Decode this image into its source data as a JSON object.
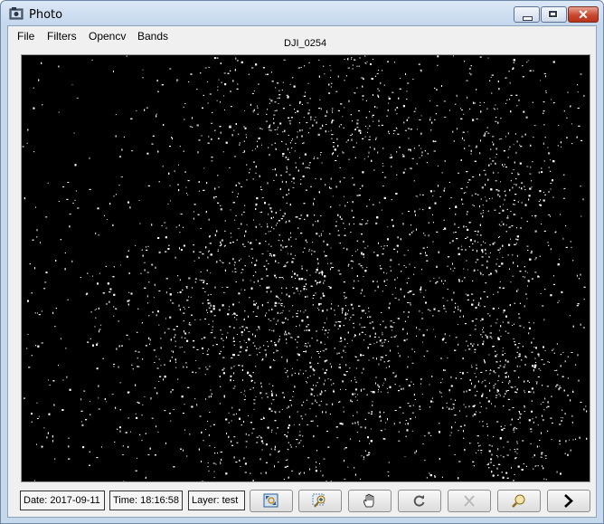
{
  "window": {
    "title": "Photo",
    "controls": {
      "minimize": "minimize",
      "maximize": "maximize",
      "close": "✕"
    }
  },
  "menu": {
    "items": [
      {
        "label": "File"
      },
      {
        "label": "Filters"
      },
      {
        "label": "Opencv"
      },
      {
        "label": "Bands"
      }
    ]
  },
  "photo": {
    "name": "DJI_0254",
    "content": "black background with scattered white edge-detection speckles"
  },
  "status": {
    "date": "Date: 2017-09-11",
    "time": "Time: 18:16:58",
    "layer": "Layer: test"
  },
  "toolbar": {
    "buttons": [
      {
        "icon": "zoom-fit-icon"
      },
      {
        "icon": "zoom-in-icon"
      },
      {
        "icon": "pan-hand-icon"
      },
      {
        "icon": "rotate-icon"
      },
      {
        "icon": "clear-x-icon"
      },
      {
        "icon": "zoom-out-icon"
      },
      {
        "icon": "next-arrow-icon"
      }
    ]
  },
  "colors": {
    "titlebar": "#c4d7ed",
    "close_button": "#c8482f",
    "canvas": "#000000",
    "speckle": "#ffffff"
  }
}
